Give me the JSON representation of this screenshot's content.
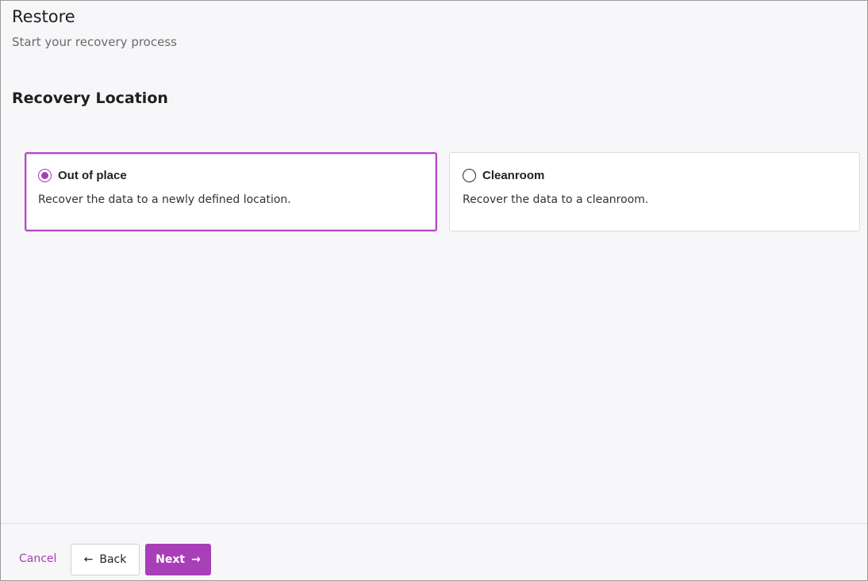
{
  "header": {
    "title": "Restore",
    "subtitle": "Start your recovery process"
  },
  "section": {
    "title": "Recovery Location"
  },
  "options": [
    {
      "label": "Out of place",
      "description": "Recover the data to a newly defined location.",
      "selected": true
    },
    {
      "label": "Cleanroom",
      "description": "Recover the data to a cleanroom.",
      "selected": false
    }
  ],
  "footer": {
    "cancel_label": "Cancel",
    "back_label": "Back",
    "next_label": "Next"
  },
  "icons": {
    "back": "arrow-left-icon",
    "next": "arrow-right-icon"
  },
  "colors": {
    "accent": "#a83fb8",
    "background": "#f7f6f9"
  }
}
